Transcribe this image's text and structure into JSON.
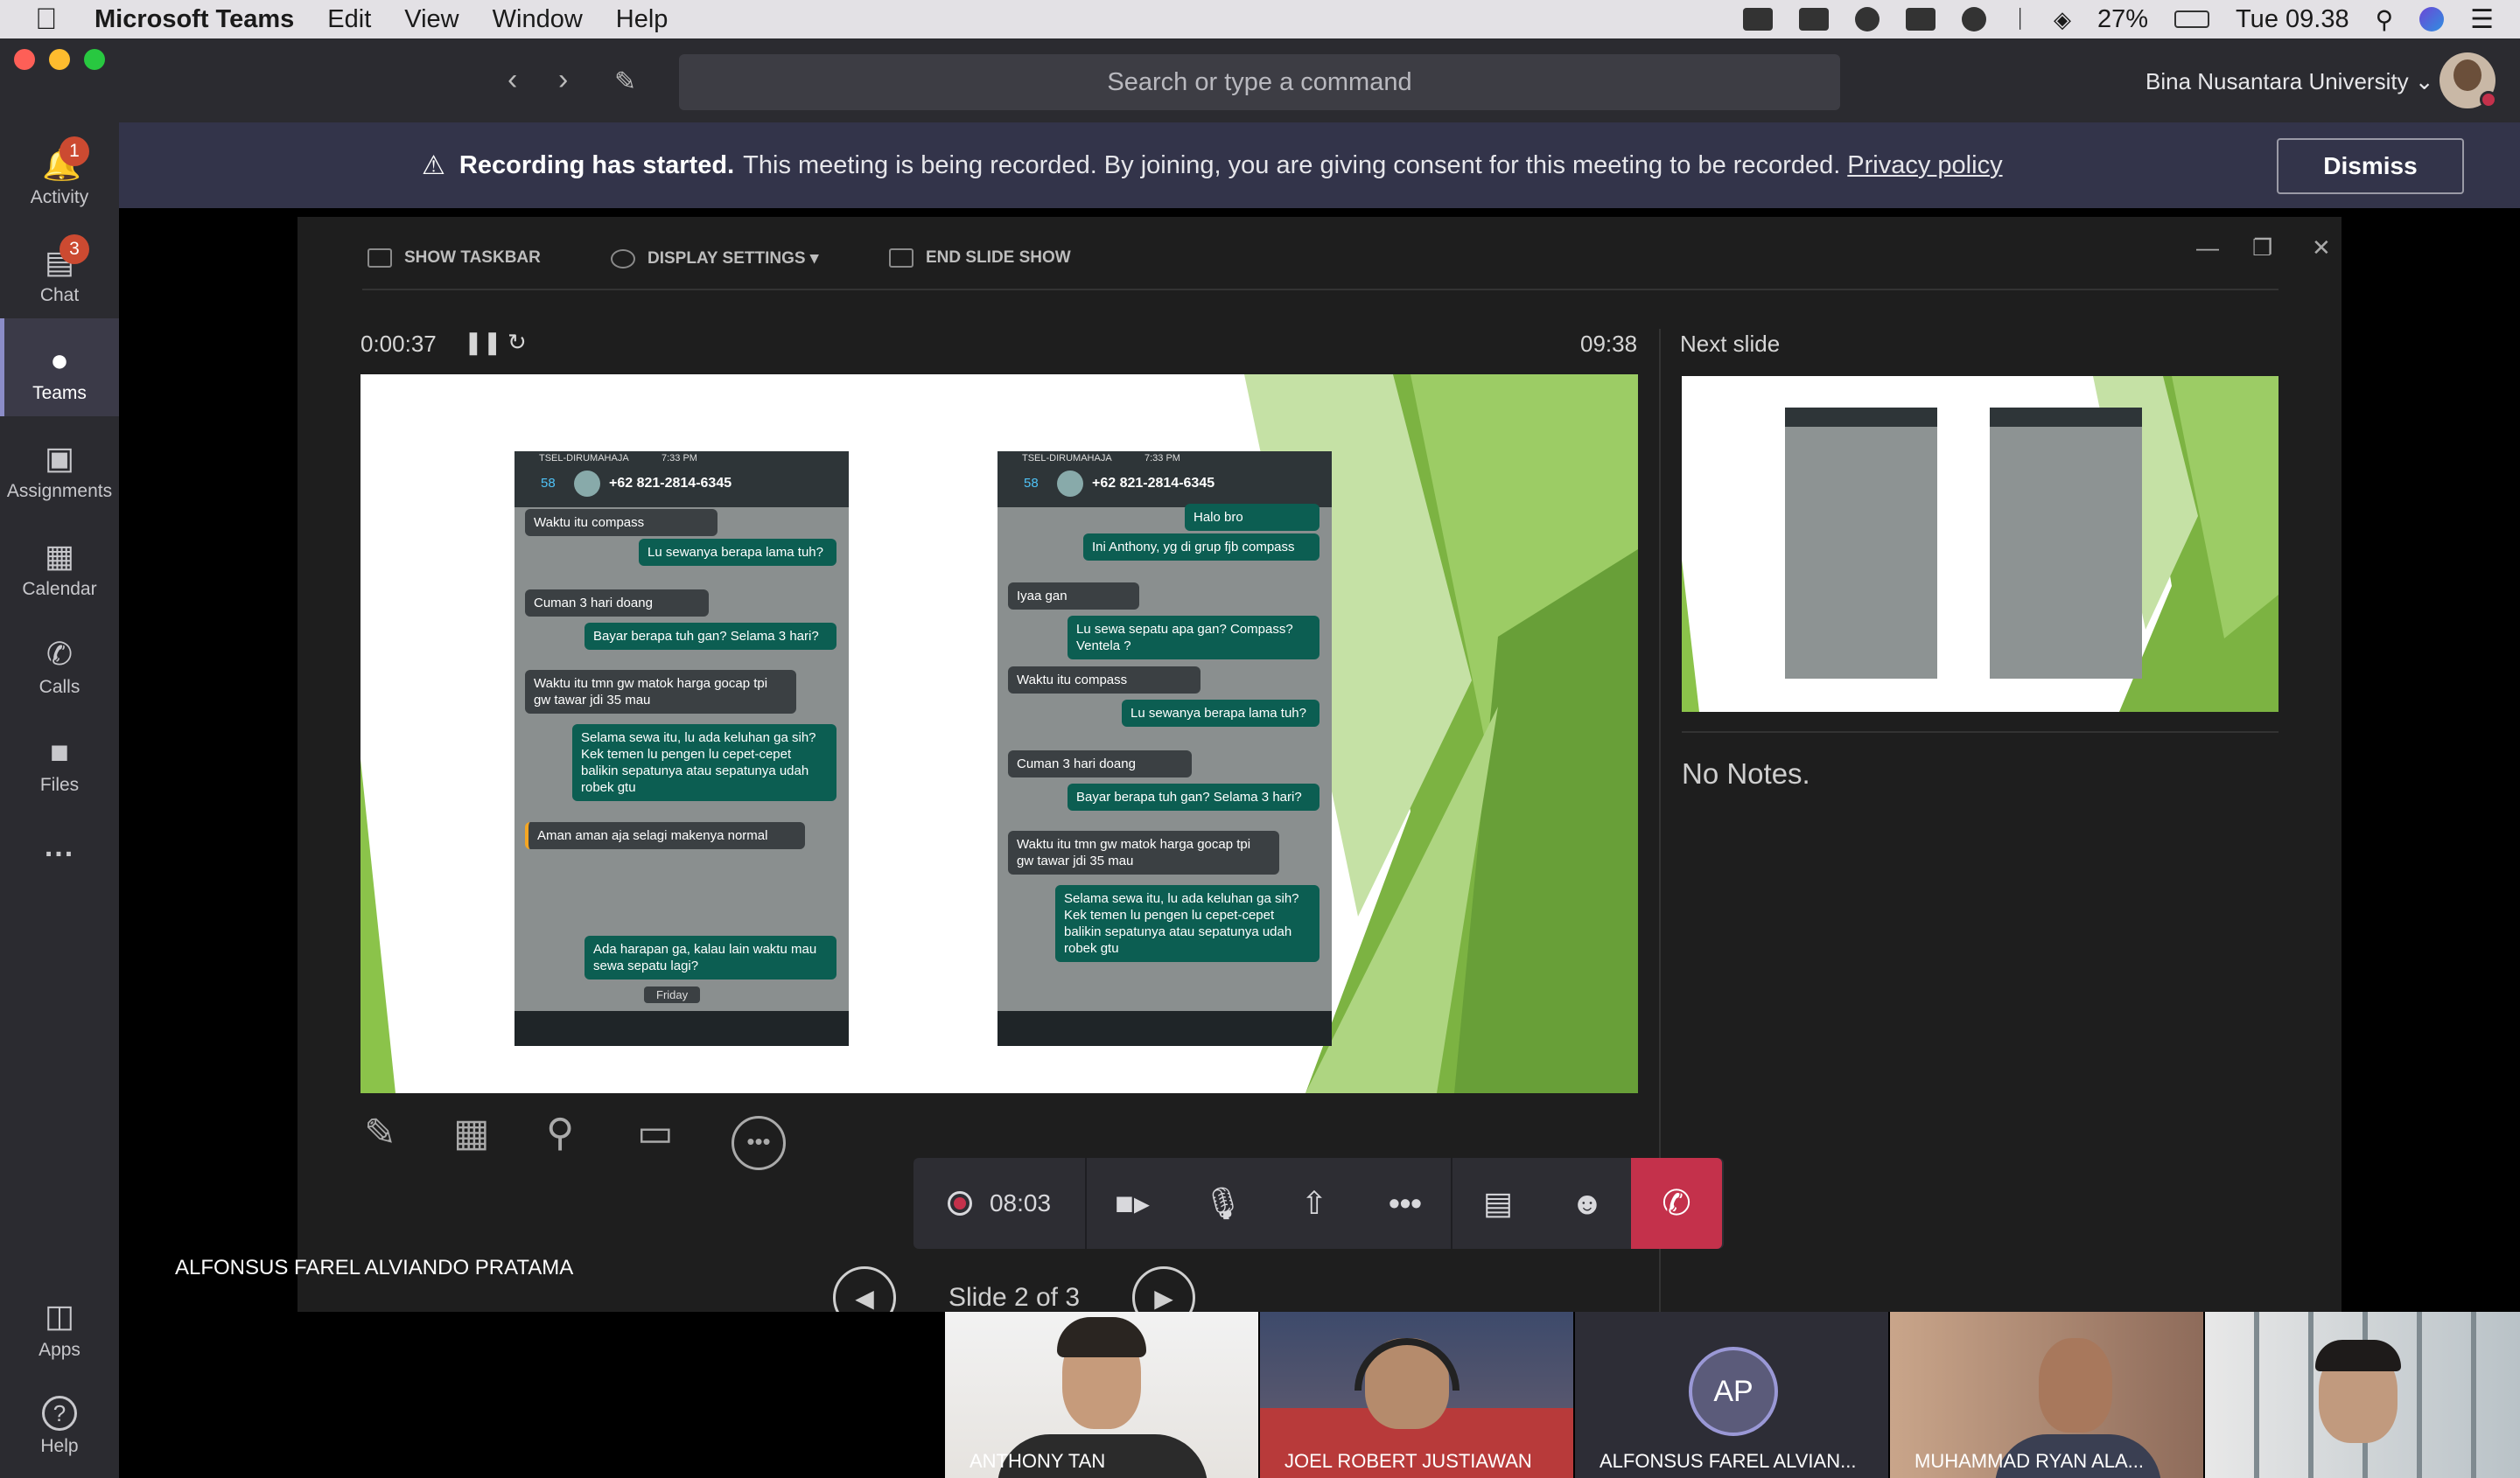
{
  "menubar": {
    "apple": "",
    "app_name": "Microsoft Teams",
    "items": [
      "Edit",
      "View",
      "Window",
      "Help"
    ],
    "battery": "27%",
    "clock": "Tue 09.38"
  },
  "titlebar": {
    "search_placeholder": "Search or type a command",
    "org_name": "Bina Nusantara University ⌄"
  },
  "rail": {
    "items": [
      {
        "label": "Activity",
        "badge": "1"
      },
      {
        "label": "Chat",
        "badge": "3"
      },
      {
        "label": "Teams"
      },
      {
        "label": "Assignments"
      },
      {
        "label": "Calendar"
      },
      {
        "label": "Calls"
      },
      {
        "label": "Files"
      },
      {
        "label": "..."
      }
    ],
    "apps_label": "Apps",
    "help_label": "Help"
  },
  "banner": {
    "title": "Recording has started.",
    "message": "This meeting is being recorded. By joining, you are giving consent for this meeting to be recorded.",
    "link": "Privacy policy",
    "dismiss": "Dismiss"
  },
  "presenter_view": {
    "toolbar": {
      "show_taskbar": "SHOW TASKBAR",
      "display_settings": "DISPLAY SETTINGS ▾",
      "end_slide_show": "END SLIDE SHOW"
    },
    "elapsed": "0:00:37",
    "clock": "09:38",
    "next_slide_label": "Next slide",
    "notes": "No Notes.",
    "slide_position": "Slide 2 of 3"
  },
  "slide": {
    "phone1": {
      "carrier": "TSEL-DIRUMAHAJA",
      "time": "7:33 PM",
      "contact": "+62 821-2814-6345",
      "back": "58",
      "messages": [
        {
          "dir": "in",
          "text": "Waktu itu compass"
        },
        {
          "dir": "out",
          "text": "Lu sewanya berapa lama tuh?"
        },
        {
          "dir": "in",
          "text": "Cuman 3 hari doang"
        },
        {
          "dir": "out",
          "text": "Bayar berapa tuh gan? Selama 3 hari?"
        },
        {
          "dir": "in",
          "text": "Waktu itu tmn gw matok harga gocap tpi gw tawar jdi 35 mau"
        },
        {
          "dir": "out",
          "text": "Selama sewa itu, lu ada keluhan ga sih? Kek temen lu pengen lu cepet-cepet balikin sepatunya atau sepatunya udah robek gtu"
        },
        {
          "dir": "in",
          "text": "Aman aman aja selagi makenya normal"
        },
        {
          "dir": "out",
          "text": "Ada harapan ga, kalau lain waktu mau sewa sepatu lagi?"
        }
      ],
      "day": "Friday"
    },
    "phone2": {
      "carrier": "TSEL-DIRUMAHAJA",
      "time": "7:33 PM",
      "contact": "+62 821-2814-6345",
      "back": "58",
      "messages": [
        {
          "dir": "out",
          "text": "Halo bro"
        },
        {
          "dir": "out",
          "text": "Ini Anthony, yg di grup fjb compass"
        },
        {
          "dir": "in",
          "text": "Iyaa gan"
        },
        {
          "dir": "out",
          "text": "Lu sewa sepatu apa gan? Compass? Ventela ?"
        },
        {
          "dir": "in",
          "text": "Waktu itu compass"
        },
        {
          "dir": "out",
          "text": "Lu sewanya berapa lama tuh?"
        },
        {
          "dir": "in",
          "text": "Cuman 3 hari doang"
        },
        {
          "dir": "out",
          "text": "Bayar berapa tuh gan? Selama 3 hari?"
        },
        {
          "dir": "in",
          "text": "Waktu itu tmn gw matok harga gocap tpi gw tawar jdi 35 mau"
        },
        {
          "dir": "out",
          "text": "Selama sewa itu, lu ada keluhan ga sih? Kek temen lu pengen lu cepet-cepet balikin sepatunya atau sepatunya udah robek gtu"
        }
      ]
    }
  },
  "call": {
    "duration": "08:03",
    "presenter_name": "ALFONSUS FAREL ALVIANDO PRATAMA"
  },
  "participants": [
    {
      "name": "ANTHONY TAN"
    },
    {
      "name": "JOEL ROBERT JUSTIAWAN"
    },
    {
      "name": "ALFONSUS FAREL ALVIAN...",
      "initials": "AP"
    },
    {
      "name": "MUHAMMAD RYAN ALA..."
    },
    {
      "name": ""
    }
  ],
  "colors": {
    "accent": "#8b8cc7",
    "hangup": "#c4314b",
    "slide_green": "#8dc63f",
    "banner": "#33344a"
  }
}
